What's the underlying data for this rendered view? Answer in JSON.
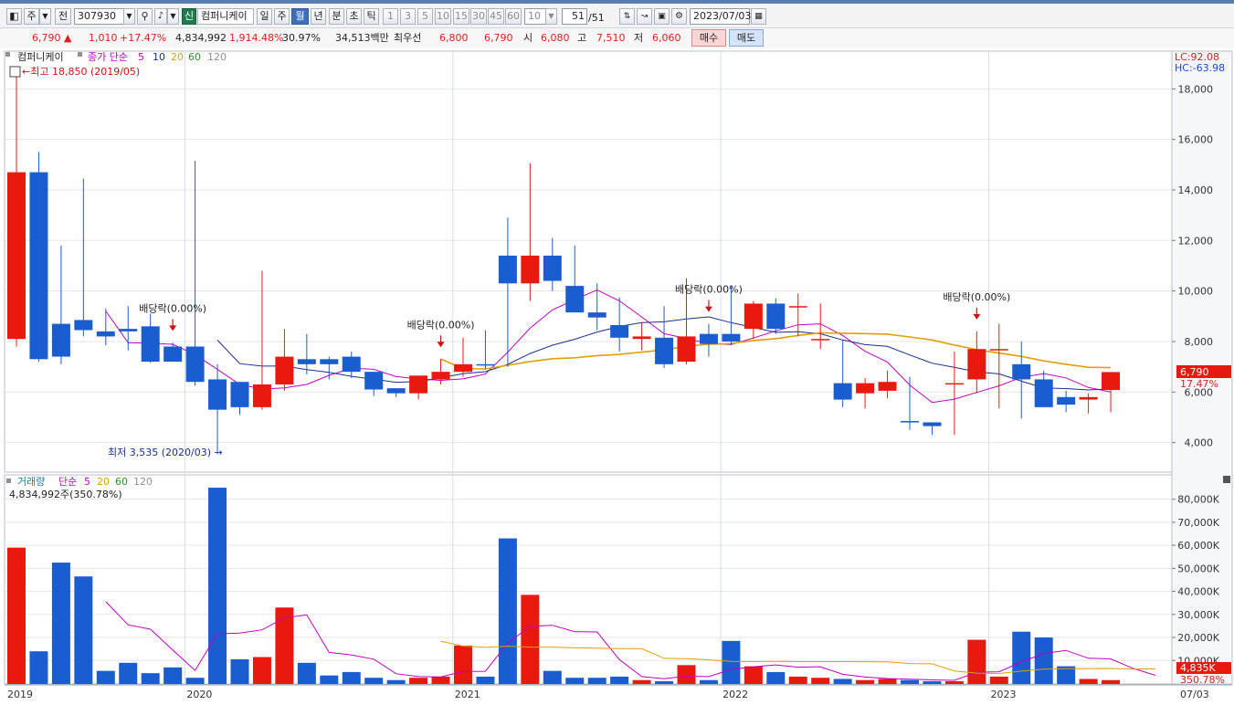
{
  "toolbar": {
    "mode_icon": "chart-mode-icon",
    "period_unit": "주",
    "prev_label": "전",
    "code": "307930",
    "search_icon": "magnifier-icon",
    "sound_icon": "speaker-icon",
    "new_badge": "신",
    "stock_name": "컴퍼니케이",
    "period_buttons": [
      "일",
      "주",
      "월",
      "년",
      "분",
      "초",
      "틱"
    ],
    "selected_period": "월",
    "interval_buttons": [
      "1",
      "3",
      "5",
      "10",
      "15",
      "30",
      "45",
      "60"
    ],
    "interval_select": "10",
    "count_value": "51",
    "count_total": "/51",
    "date": "2023/07/03"
  },
  "quote": {
    "price": "6,790",
    "arrow": "▲",
    "change": "1,010",
    "change_pct": "+17.47%",
    "volume": "4,834,992",
    "volume_ratio": "1,914.48%",
    "turnover": "30.97%",
    "amount": "34,513백만",
    "best_label": "최우선",
    "ask": "6,800",
    "bid": "6,790",
    "open_label": "시",
    "open": "6,080",
    "high_label": "고",
    "high": "7,510",
    "low_label": "저",
    "low": "6,060",
    "buy_label": "매수",
    "sell_label": "매도"
  },
  "price_panel": {
    "legend_name": "컴퍼니케이",
    "legend_ma_label": "종가 단순",
    "ma_periods": [
      "5",
      "10",
      "20",
      "60",
      "120"
    ],
    "ma_colors": [
      "#c000c0",
      "#1a2f8a",
      "#e0a000",
      "#2a8f2a",
      "#909090"
    ],
    "lc_label": "LC:92.08",
    "hc_label": "HC:-63.98",
    "max_label": "최고 18,850 (2019/05)",
    "min_label": "최저 3,535 (2020/03)",
    "dividend_label": "배당락(0.00%)",
    "current_price_tag": "6,790",
    "current_change_tag": "17.47%",
    "y_ticks": [
      4000,
      6000,
      8000,
      10000,
      12000,
      14000,
      16000,
      18000
    ],
    "y_tick_labels": [
      "4,000",
      "6,000",
      "8,000",
      "10,000",
      "12,000",
      "14,000",
      "16,000",
      "18,000"
    ]
  },
  "volume_panel": {
    "legend_name": "거래량",
    "legend_ma_label": "단순",
    "ma_periods": [
      "5",
      "20",
      "60",
      "120"
    ],
    "current_volume_label": "4,834,992주(350.78%)",
    "current_volume_tag": "4,835K",
    "current_ratio_tag": "350.78%",
    "y_ticks": [
      10000,
      20000,
      30000,
      40000,
      50000,
      60000,
      70000,
      80000
    ],
    "y_tick_labels": [
      "10,000K",
      "20,000K",
      "30,000K",
      "40,000K",
      "50,000K",
      "60,000K",
      "70,000K",
      "80,000K"
    ]
  },
  "x_axis": {
    "year_labels": [
      "2019",
      "2020",
      "2021",
      "2022",
      "2023",
      "07/03"
    ]
  },
  "colors": {
    "up": "#e8190f",
    "down": "#1a5dd1",
    "ma5": "#c000c0",
    "ma10": "#1a2f8a",
    "ma20": "#e0a000",
    "dividend_arrow": "#d01010"
  },
  "chart_data": {
    "type": "candlestick",
    "interval": "monthly",
    "periods": [
      "2019/05",
      "2019/06",
      "2019/07",
      "2019/08",
      "2019/09",
      "2019/10",
      "2019/11",
      "2019/12",
      "2020/01",
      "2020/02",
      "2020/03",
      "2020/04",
      "2020/05",
      "2020/06",
      "2020/07",
      "2020/08",
      "2020/09",
      "2020/10",
      "2020/11",
      "2020/12",
      "2021/01",
      "2021/02",
      "2021/03",
      "2021/04",
      "2021/05",
      "2021/06",
      "2021/07",
      "2021/08",
      "2021/09",
      "2021/10",
      "2021/11",
      "2021/12",
      "2022/01",
      "2022/02",
      "2022/03",
      "2022/04",
      "2022/05",
      "2022/06",
      "2022/07",
      "2022/08",
      "2022/09",
      "2022/10",
      "2022/11",
      "2022/12",
      "2023/01",
      "2023/02",
      "2023/03",
      "2023/04",
      "2023/05",
      "2023/06",
      "2023/07"
    ],
    "open": [
      8100,
      14700,
      8700,
      8850,
      8400,
      8500,
      8600,
      7800,
      7800,
      6500,
      6400,
      5400,
      6300,
      7300,
      7300,
      7400,
      6800,
      6150,
      5950,
      6500,
      6800,
      7100,
      11400,
      10300,
      11400,
      10200,
      9150,
      8650,
      8100,
      8150,
      7200,
      8300,
      8300,
      8500,
      9500,
      9400,
      8100,
      6350,
      5950,
      6050,
      4850,
      4800,
      6350,
      6500,
      7700,
      7100,
      6500,
      5800,
      5700,
      6080
    ],
    "close": [
      14700,
      7300,
      7400,
      8450,
      8200,
      8400,
      7200,
      7200,
      6400,
      5300,
      5400,
      6300,
      7400,
      7100,
      7100,
      6800,
      6100,
      5950,
      6650,
      6800,
      7100,
      7050,
      10300,
      11400,
      10400,
      9150,
      8950,
      8150,
      8200,
      7100,
      8200,
      7900,
      8000,
      9500,
      8500,
      9400,
      8100,
      5700,
      6350,
      6400,
      4830,
      4650,
      6350,
      7700,
      7700,
      6500,
      5400,
      5500,
      5800,
      6790
    ],
    "high": [
      18850,
      15500,
      11800,
      14450,
      9300,
      9400,
      9100,
      7950,
      15150,
      7100,
      6250,
      10800,
      8500,
      8300,
      7400,
      7600,
      6700,
      6150,
      6500,
      7300,
      8150,
      8450,
      12900,
      15050,
      12100,
      11800,
      10300,
      9750,
      8750,
      9400,
      10500,
      8700,
      10200,
      9600,
      9700,
      9900,
      9500,
      8050,
      6550,
      6850,
      6600,
      4800,
      7600,
      8400,
      8700,
      8000,
      6850,
      6050,
      5950,
      6150,
      7510
    ],
    "low": [
      7800,
      7200,
      7100,
      8200,
      7850,
      7650,
      7150,
      7300,
      6250,
      3535,
      5100,
      5300,
      6050,
      6700,
      6500,
      6550,
      5850,
      5800,
      5700,
      6300,
      6600,
      6900,
      7000,
      9600,
      10000,
      9500,
      8450,
      7600,
      7650,
      6950,
      7100,
      7400,
      7850,
      8100,
      8300,
      8200,
      7700,
      5400,
      5350,
      5750,
      4500,
      4300,
      4300,
      5950,
      5350,
      4950,
      5650,
      5200,
      5150,
      5200,
      6060
    ],
    "volume_k": [
      59000,
      14000,
      52500,
      46500,
      5500,
      9000,
      4500,
      7000,
      2500,
      85000,
      10500,
      11500,
      33000,
      9000,
      3500,
      5000,
      2500,
      1500,
      2500,
      3000,
      16500,
      3000,
      63000,
      38500,
      5500,
      2500,
      2500,
      3000,
      1500,
      1000,
      8000,
      1500,
      18500,
      7500,
      5000,
      3000,
      2500,
      2000,
      1500,
      2000,
      1500,
      1000,
      1000,
      19000,
      3000,
      22500,
      20000,
      7500,
      2000,
      1500,
      2000,
      4835
    ],
    "dividend_markers": [
      "2019/12",
      "2020/12",
      "2021/12",
      "2022/12"
    ]
  }
}
